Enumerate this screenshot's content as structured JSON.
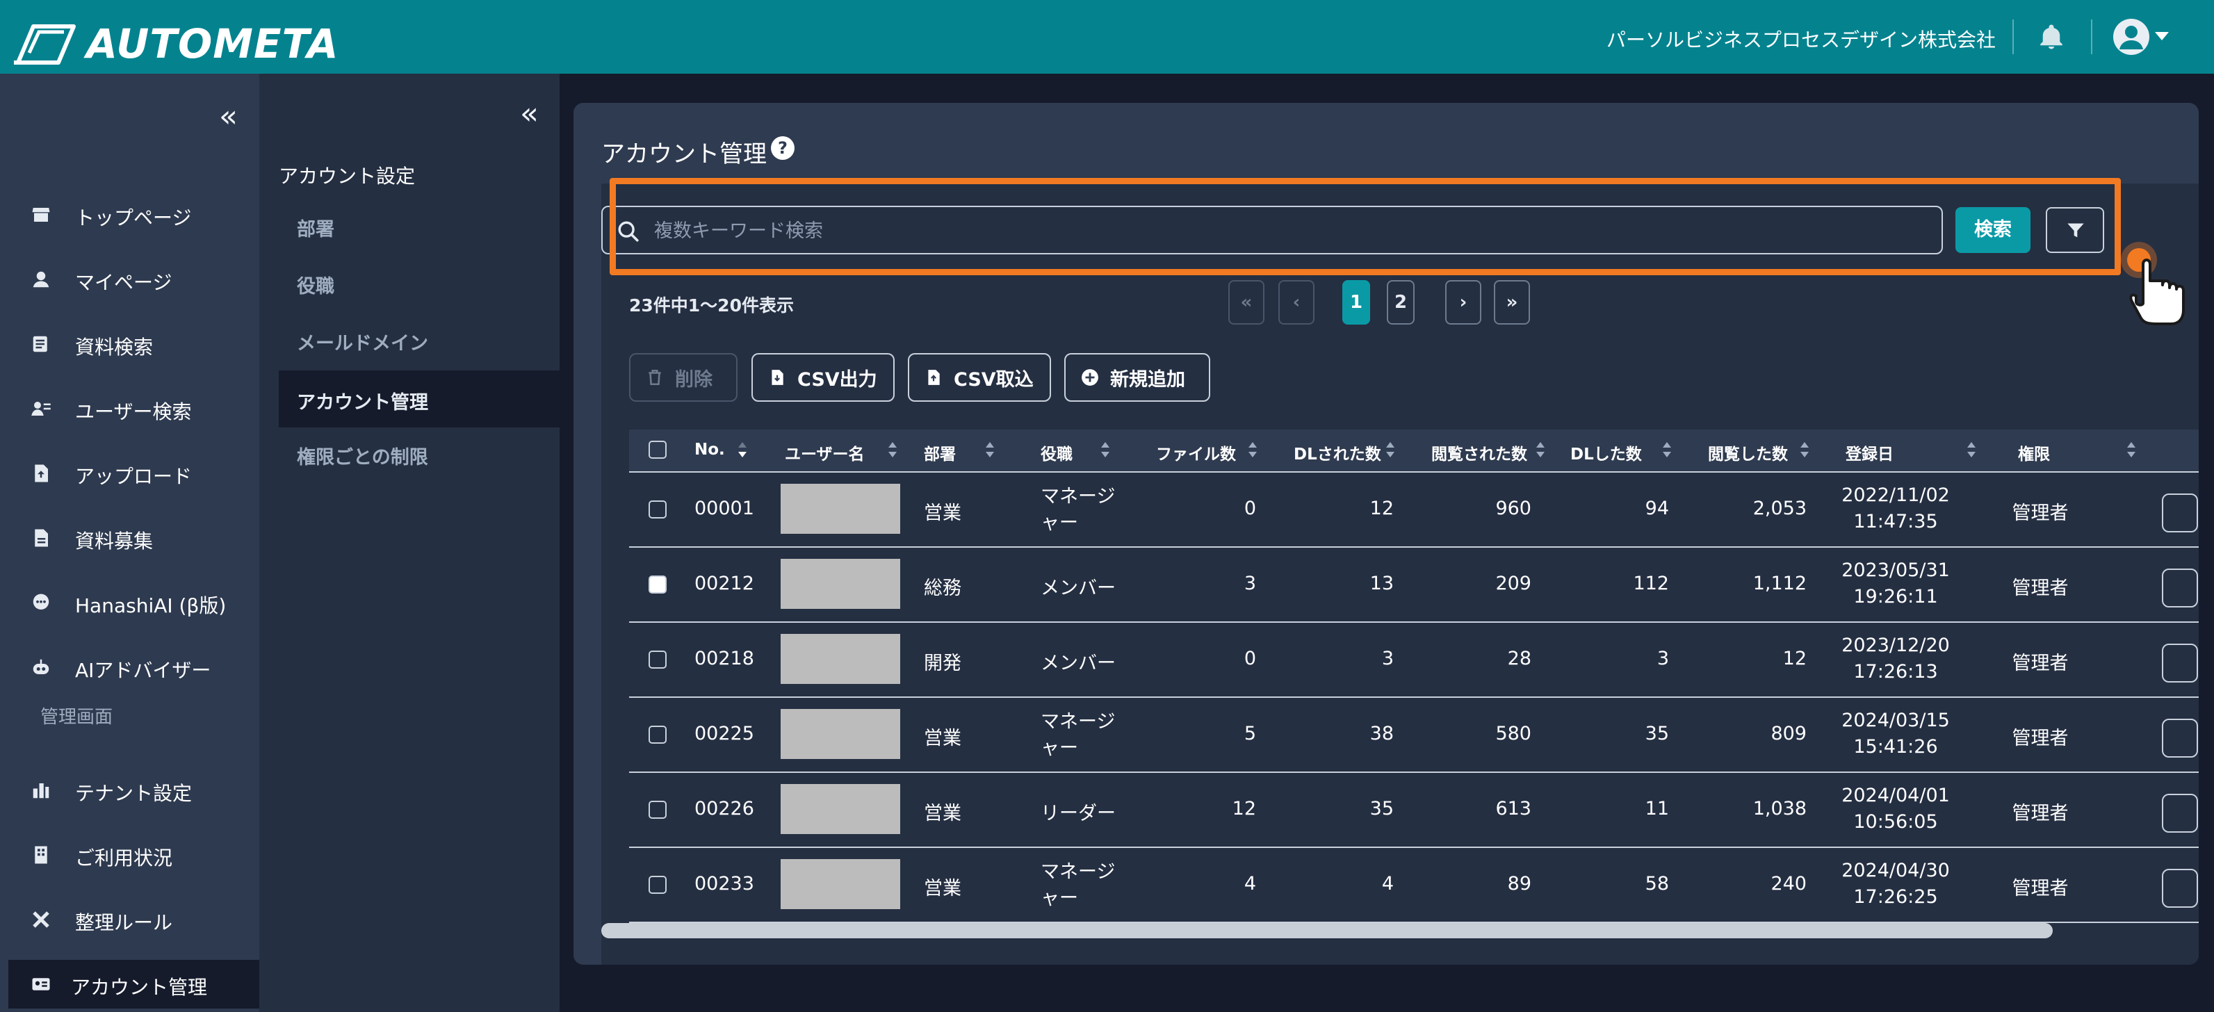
{
  "app": {
    "brand": "AUTOMETA",
    "company": "パーソルビジネスプロセスデザイン株式会社"
  },
  "nav": {
    "items": [
      {
        "label": "トップページ",
        "icon": "store-icon"
      },
      {
        "label": "マイページ",
        "icon": "person-icon"
      },
      {
        "label": "資料検索",
        "icon": "document-search-icon"
      },
      {
        "label": "ユーザー検索",
        "icon": "user-search-icon"
      },
      {
        "label": "アップロード",
        "icon": "upload-file-icon"
      },
      {
        "label": "資料募集",
        "icon": "document-icon"
      },
      {
        "label": "HanashiAI (β版)",
        "icon": "chat-icon"
      },
      {
        "label": "AIアドバイザー",
        "icon": "robot-icon"
      }
    ],
    "section_label": "管理画面",
    "admin_items": [
      {
        "label": "テナント設定",
        "icon": "tenant-icon"
      },
      {
        "label": "ご利用状況",
        "icon": "building-icon"
      },
      {
        "label": "整理ルール",
        "icon": "tools-icon"
      },
      {
        "label": "アカウント管理",
        "icon": "id-card-icon"
      }
    ]
  },
  "subnav": {
    "heading": "アカウント設定",
    "items": [
      "部署",
      "役職",
      "メールドメイン",
      "アカウント管理",
      "権限ごとの制限"
    ],
    "active_index": 3
  },
  "page": {
    "title": "アカウント管理",
    "search_placeholder": "複数キーワード検索",
    "search_button": "検索",
    "count_text": "23件中1〜20件表示",
    "pagination": {
      "first": "«",
      "prev": "‹",
      "pages": [
        "1",
        "2"
      ],
      "current": "1",
      "next": "›",
      "last": "»"
    },
    "actions": {
      "delete": "削除",
      "csv_export": "CSV出力",
      "csv_import": "CSV取込",
      "add_new": "新規追加"
    }
  },
  "table": {
    "headers": [
      "No.",
      "ユーザー名",
      "部署",
      "役職",
      "ファイル数",
      "DLされた数",
      "閲覧された数",
      "DLした数",
      "閲覧した数",
      "登録日",
      "権限"
    ],
    "rows": [
      {
        "no": "00001",
        "dept": "営業",
        "role": [
          "マネージ",
          "ャー"
        ],
        "files": "0",
        "dl_received": "12",
        "views_received": "960",
        "dl_done": "94",
        "views_done": "2,053",
        "date": "2022/11/02",
        "time": "11:47:35",
        "perm": "管理者",
        "checked": false
      },
      {
        "no": "00212",
        "dept": "総務",
        "role": [
          "メンバー"
        ],
        "files": "3",
        "dl_received": "13",
        "views_received": "209",
        "dl_done": "112",
        "views_done": "1,112",
        "date": "2023/05/31",
        "time": "19:26:11",
        "perm": "管理者",
        "checked": true
      },
      {
        "no": "00218",
        "dept": "開発",
        "role": [
          "メンバー"
        ],
        "files": "0",
        "dl_received": "3",
        "views_received": "28",
        "dl_done": "3",
        "views_done": "12",
        "date": "2023/12/20",
        "time": "17:26:13",
        "perm": "管理者",
        "checked": false
      },
      {
        "no": "00225",
        "dept": "営業",
        "role": [
          "マネージ",
          "ャー"
        ],
        "files": "5",
        "dl_received": "38",
        "views_received": "580",
        "dl_done": "35",
        "views_done": "809",
        "date": "2024/03/15",
        "time": "15:41:26",
        "perm": "管理者",
        "checked": false
      },
      {
        "no": "00226",
        "dept": "営業",
        "role": [
          "リーダー"
        ],
        "files": "12",
        "dl_received": "35",
        "views_received": "613",
        "dl_done": "11",
        "views_done": "1,038",
        "date": "2024/04/01",
        "time": "10:56:05",
        "perm": "管理者",
        "checked": false
      },
      {
        "no": "00233",
        "dept": "営業",
        "role": [
          "マネージ",
          "ャー"
        ],
        "files": "4",
        "dl_received": "4",
        "views_received": "89",
        "dl_done": "58",
        "views_done": "240",
        "date": "2024/04/30",
        "time": "17:26:25",
        "perm": "管理者",
        "checked": false
      }
    ]
  },
  "colors": {
    "topbar": "#04838f",
    "accent": "#0a9aa6",
    "highlight": "#f27a22"
  }
}
